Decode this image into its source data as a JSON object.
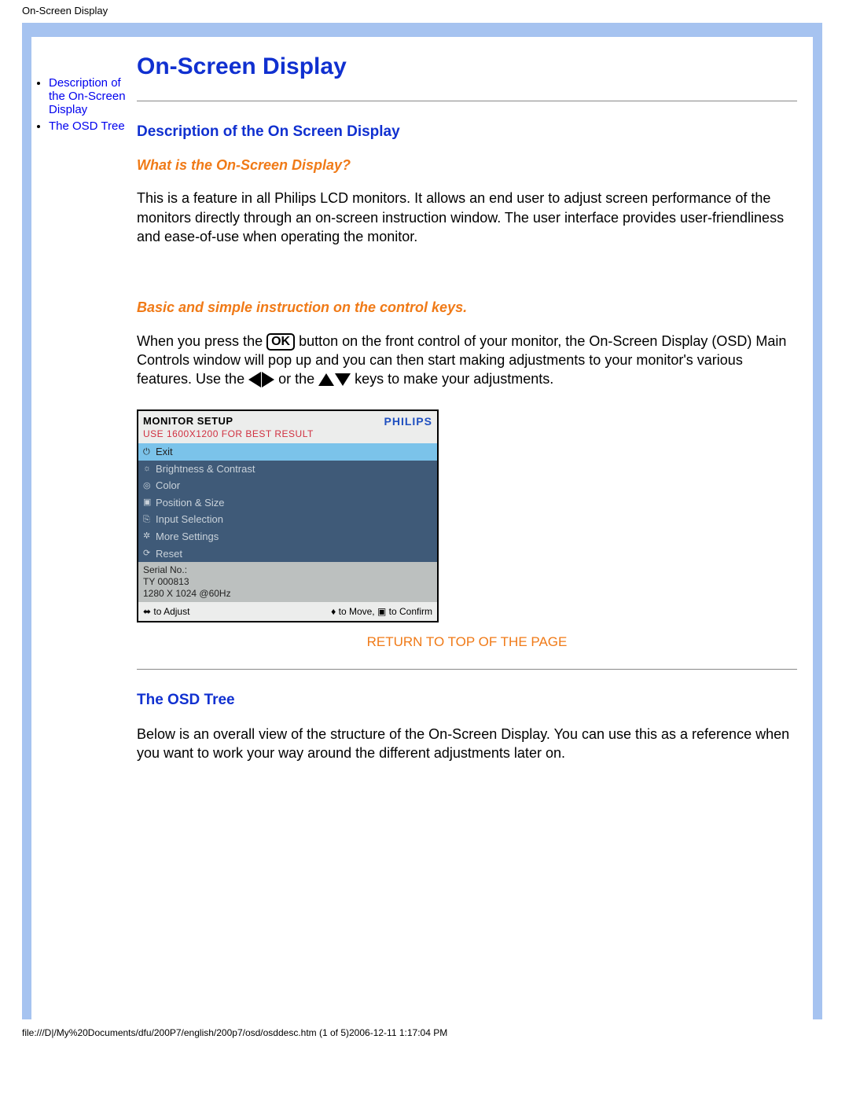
{
  "page": {
    "header_title": "On-Screen Display",
    "main_title": "On-Screen Display",
    "footer": "file:///D|/My%20Documents/dfu/200P7/english/200p7/osd/osddesc.htm (1 of 5)2006-12-11 1:17:04 PM"
  },
  "sidebar": {
    "items": [
      {
        "label": "Description of the On-Screen Display"
      },
      {
        "label": "The OSD Tree"
      }
    ]
  },
  "content": {
    "section1_heading": "Description of the On Screen Display",
    "q1": "What is the On-Screen Display?",
    "p1": "This is a feature in all Philips LCD monitors. It allows an end user to adjust screen performance of the monitors directly through an on-screen instruction window. The user interface provides user-friendliness and ease-of-use when operating the monitor.",
    "q2": "Basic and simple instruction on the control keys.",
    "p2a": "When you press the ",
    "ok_label": "OK",
    "p2b": " button on the front control of your monitor, the On-Screen Display (OSD) Main Controls window will pop up and you can then start making adjustments to your monitor's various features. Use the ",
    "p2c": " or the ",
    "p2d": " keys to make your adjustments.",
    "return_label": "RETURN TO TOP OF THE PAGE",
    "section2_heading": "The OSD Tree",
    "p3": "Below is an overall view of the structure of the On-Screen Display. You can use this as a reference when you want to work your way around the different adjustments later on."
  },
  "osd": {
    "title": "MONITOR SETUP",
    "hint": "USE 1600X1200 FOR BEST RESULT",
    "brand": "PHILIPS",
    "menu": [
      "Exit",
      "Brightness & Contrast",
      "Color",
      "Position & Size",
      "Input Selection",
      "More Settings",
      "Reset"
    ],
    "serial_label": "Serial No.:",
    "serial_value": "TY 000813",
    "mode": "1280 X 1024 @60Hz",
    "bottom_left": "⬌ to Adjust",
    "bottom_right": "♦ to Move, ▣ to Confirm"
  }
}
